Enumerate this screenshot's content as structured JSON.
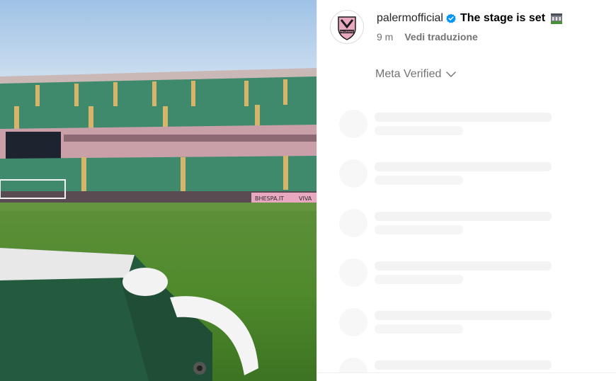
{
  "post": {
    "username": "palermofficial",
    "caption": "The stage is set",
    "caption_emoji": "stadium-emoji-icon",
    "time": "9 m",
    "translate_label": "Vedi traduzione",
    "meta_verified_label": "Meta Verified",
    "avatar_logo_text": "PALERMO"
  },
  "media": {
    "banner_text": "BHESPA.IT",
    "banner_text_2": "VIVA"
  },
  "colors": {
    "verified_blue": "#0095f6",
    "text_primary": "#262626",
    "text_secondary": "#737373",
    "palermo_pink": "#e9a7c0"
  },
  "loading_comments": [
    1,
    2,
    3,
    4,
    5,
    6
  ]
}
